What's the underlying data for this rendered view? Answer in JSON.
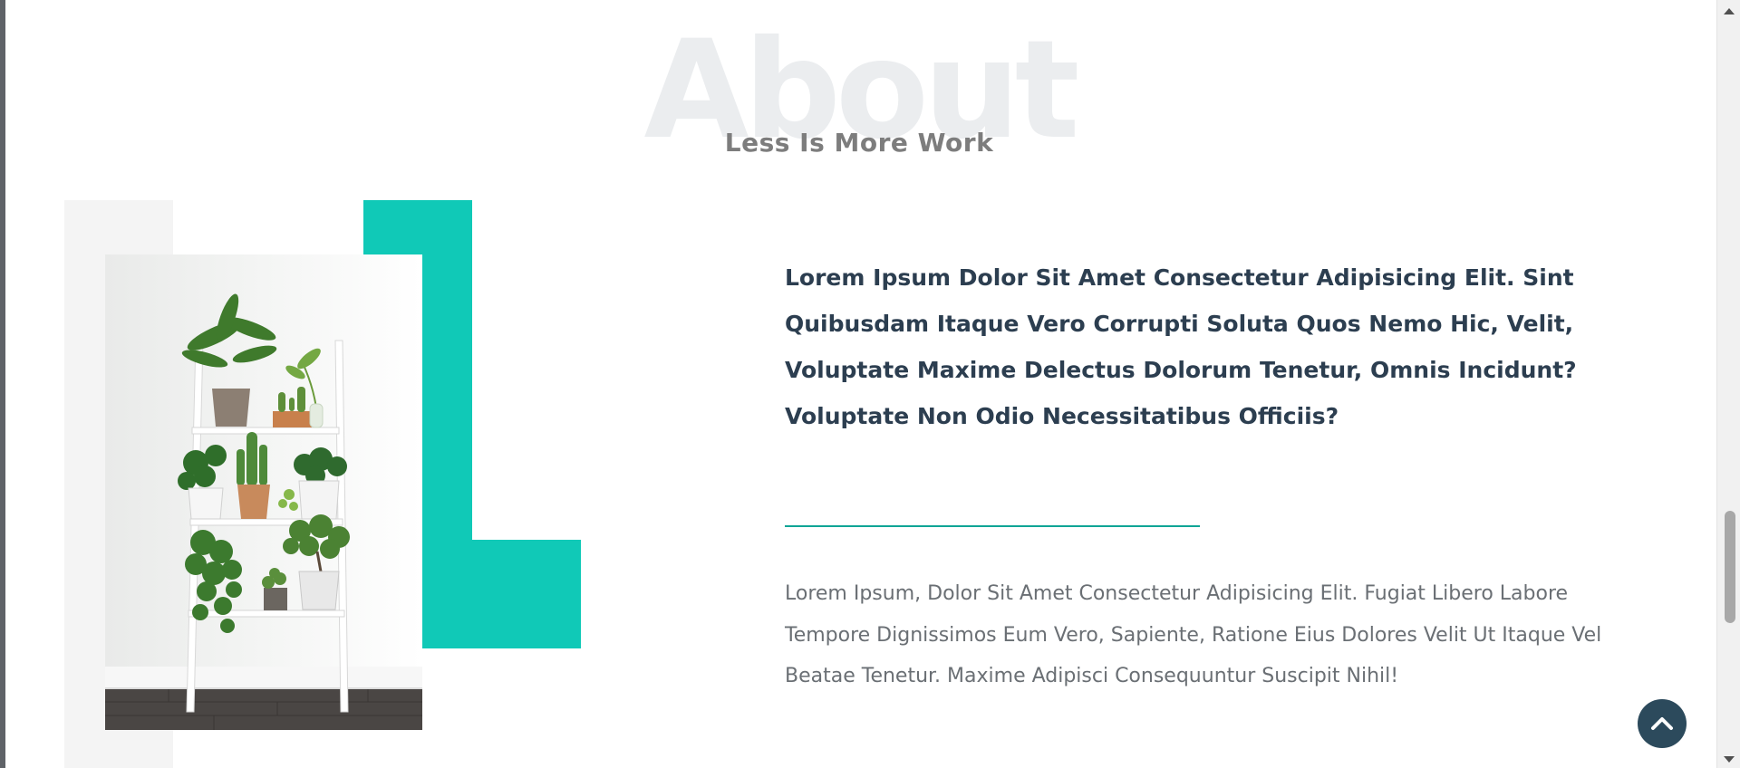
{
  "about": {
    "bg_word": "About",
    "subtitle": "Less Is More Work",
    "headline": "Lorem Ipsum Dolor Sit Amet Consectetur Adipisicing Elit. Sint Quibusdam Itaque Vero Corrupti Soluta Quos Nemo Hic, Velit, Voluptate Maxime Delectus Dolorum Tenetur, Omnis Incidunt? Voluptate Non Odio Necessitatibus Officiis?",
    "body": "Lorem Ipsum, Dolor Sit Amet Consectetur Adipisicing Elit. Fugiat Libero Labore Tempore Dignissimos Eum Vero, Sapiente, Ratione Eius Dolores Velit Ut Itaque Vel Beatae Tenetur. Maxime Adipisci Consequuntur Suscipit Nihil!"
  },
  "colors": {
    "accent": "#10c9b7",
    "heading": "#2c3e50",
    "button": "#2c4a5c"
  },
  "icons": {
    "back_to_top": "chevron-up-icon"
  }
}
